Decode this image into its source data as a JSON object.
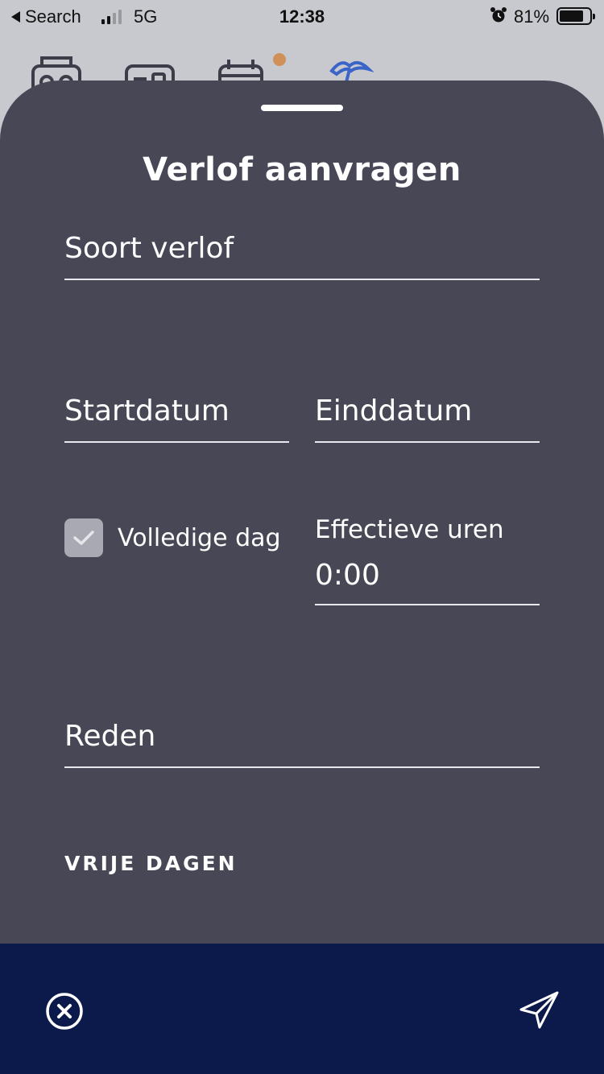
{
  "status_bar": {
    "back_label": "Search",
    "network": "5G",
    "time": "12:38",
    "battery_percent": "81%",
    "battery_level": 0.81,
    "signal_bars": 2
  },
  "background_nav": {
    "icons": [
      "radio-icon",
      "card-icon",
      "calendar-icon",
      "palm-tree-icon"
    ],
    "active_icon": "palm-tree-icon",
    "accent_color": "#3a64c8",
    "badge_color": "#d0905a"
  },
  "sheet": {
    "title": "Verlof aanvragen",
    "leave_type": {
      "label": "Soort verlof",
      "value": ""
    },
    "start_date": {
      "label": "Startdatum",
      "value": ""
    },
    "end_date": {
      "label": "Einddatum",
      "value": ""
    },
    "full_day": {
      "label": "Volledige dag",
      "checked": true
    },
    "effective_hours": {
      "label": "Effectieve uren",
      "value": "0:00"
    },
    "reason": {
      "label": "Reden",
      "value": ""
    },
    "free_days_heading": "VRIJE DAGEN"
  },
  "bottom_bar": {
    "cancel_icon": "close-circle-icon",
    "send_icon": "paper-plane-icon",
    "background_color": "#0b1a4a"
  },
  "colors": {
    "sheet_background": "#474756",
    "text": "#ffffff",
    "checkbox": "#a9a9b3"
  }
}
